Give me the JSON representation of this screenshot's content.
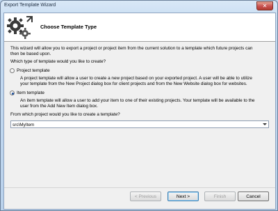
{
  "window": {
    "title": "Export Template Wizard",
    "close_glyph": "✕"
  },
  "header": {
    "title": "Choose Template Type",
    "icon": "gears-icon"
  },
  "intro": {
    "line1": "This wizard will allow you to export a project or project item from the current solution to a template which future projects can",
    "line2": "then be based upon.",
    "question": "Which type of template would you like to create?"
  },
  "options": [
    {
      "label": "Project template",
      "checked": false,
      "desc_line1": "A project template will allow a user to create a new project based on your exported project. A user will be able to utilize",
      "desc_line2": "your template from the New Project dialog box for client projects and from the New Website dialog box for websites."
    },
    {
      "label": "Item template",
      "checked": true,
      "desc_line1": "An item template will allow a user to add your item to one of their existing projects. Your template will be available to the",
      "desc_line2": "user from the Add New Item dialog box."
    }
  ],
  "project_select": {
    "label": "From which project would you like to create a template?",
    "value": "src\\MyItem"
  },
  "buttons": {
    "previous": "< Previous",
    "next": "Next >",
    "finish": "Finish",
    "cancel": "Cancel"
  }
}
